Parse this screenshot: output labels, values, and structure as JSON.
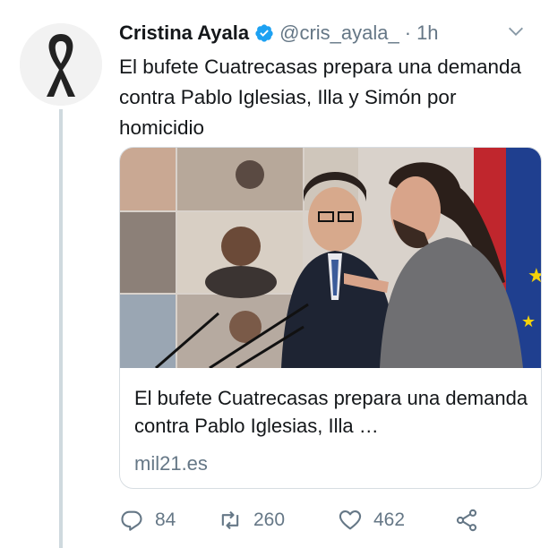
{
  "tweet": {
    "author_name": "Cristina Ayala",
    "handle": "@cris_ayala_",
    "separator": "·",
    "time": "1h",
    "text": "El bufete Cuatrecasas prepara una demanda contra Pablo Iglesias, Illa y Simón por homicidio"
  },
  "card": {
    "title": "El bufete Cuatrecasas prepara una demanda contra Pablo Iglesias, Illa …",
    "domain": "mil21.es"
  },
  "actions": {
    "replies": "84",
    "retweets": "260",
    "likes": "462"
  },
  "icons": {
    "avatar": "black-ribbon-icon",
    "verified": "verified-badge-icon",
    "menu": "chevron-down-icon",
    "reply": "reply-icon",
    "retweet": "retweet-icon",
    "like": "heart-icon",
    "share": "share-icon"
  },
  "colors": {
    "text": "#14171a",
    "secondary": "#657786",
    "verified": "#1da1f2",
    "border": "#d7dde2"
  }
}
